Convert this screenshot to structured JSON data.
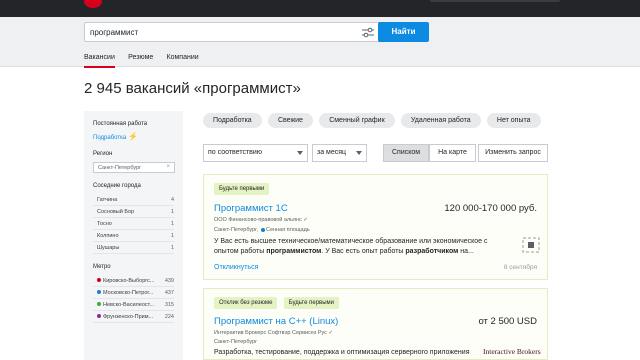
{
  "search": {
    "query": "программист",
    "button": "Найти",
    "tabs": [
      {
        "label": "Вакансии",
        "active": true
      },
      {
        "label": "Резюме",
        "active": false
      },
      {
        "label": "Компании",
        "active": false
      }
    ]
  },
  "results": {
    "title": "2 945 вакансий «программист»"
  },
  "sidebar": {
    "employment_heading": "Постоянная работа",
    "employment_link": "Подработка",
    "region_heading": "Регион",
    "region_value": "Санкт-Петербург",
    "nearby_heading": "Соседние города",
    "nearby": [
      {
        "name": "Гатчина",
        "count": "4"
      },
      {
        "name": "Сосновый Бор",
        "count": "1"
      },
      {
        "name": "Тосно",
        "count": "1"
      },
      {
        "name": "Колпино",
        "count": "1"
      },
      {
        "name": "Шушары",
        "count": "1"
      }
    ],
    "metro_heading": "Метро",
    "metro": [
      {
        "name": "Кировско-Выборгс...",
        "count": "439",
        "color": "#d6001c"
      },
      {
        "name": "Московско-Петрог...",
        "count": "437",
        "color": "#1a7fc9"
      },
      {
        "name": "Невско-Василеост...",
        "count": "315",
        "color": "#3aa845"
      },
      {
        "name": "Фрунзенско-Прим...",
        "count": "224",
        "color": "#8a2a9b"
      }
    ]
  },
  "chips": [
    "Подработка",
    "Свежие",
    "Сменный график",
    "Удаленная работа",
    "Нет опыта"
  ],
  "controls": {
    "sort": "по соответствию",
    "period": "за месяц",
    "view_list": "Списком",
    "view_map": "На карте",
    "change_request": "Изменить запрос"
  },
  "vacancies": [
    {
      "badges": [
        "Будьте первыми"
      ],
      "title": "Программист 1С",
      "salary": "120 000-170 000 руб.",
      "company": "ООО Финансово-правовой альянс",
      "city": "Санкт-Петербург,",
      "metro": "Сенная площадь",
      "desc_1": "У Вас есть высшее техническое/математическое образование или экономическое с опытом работы ",
      "desc_b1": "программистом",
      "desc_2": ". У Вас есть опыт работы ",
      "desc_b2": "разработчиком",
      "desc_3": " на...",
      "respond": "Откликнуться",
      "date": "8 сентября"
    },
    {
      "badges": [
        "Отклик без резюме",
        "Будьте первыми"
      ],
      "title": "Программист на С++ (Linux)",
      "salary": "от 2 500 USD",
      "company": "Интерактив Брокерс Софтвэр Сервисез Рус",
      "city": "Санкт-Петербург",
      "desc": "Разработка, тестирование, поддержка и оптимизация серверного приложения",
      "logo_text": "Interactive Brokers"
    }
  ],
  "colors": {
    "accent": "#0d8ae2",
    "brand": "#d6001c",
    "topbar": "#232529"
  }
}
